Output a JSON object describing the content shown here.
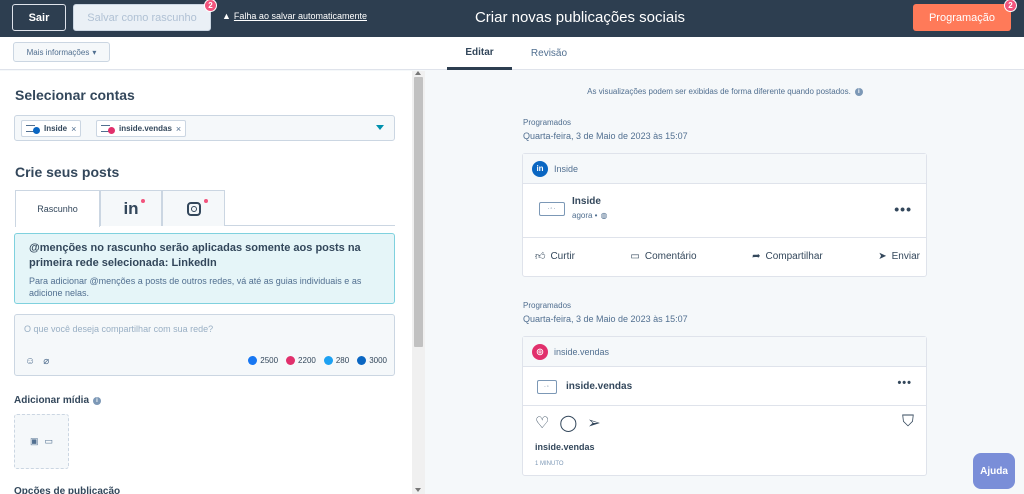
{
  "topbar": {
    "exit_label": "Sair",
    "draft_label": "Salvar como rascunho",
    "draft_badge": "2",
    "autosave_warning": "Falha ao salvar automaticamente",
    "page_title": "Criar novas publicações sociais",
    "schedule_label": "Programação",
    "schedule_badge": "2"
  },
  "tabbar": {
    "more_info": "Mais informações",
    "tab_edit": "Editar",
    "tab_review": "Revisão"
  },
  "left": {
    "select_accounts_title": "Selecionar contas",
    "accounts": [
      {
        "name": "Inside",
        "color": "#0a66c2"
      },
      {
        "name": "inside.vendas",
        "color": "#e1306c"
      }
    ],
    "create_posts_title": "Crie seus posts",
    "draft_tab": "Rascunho",
    "linkedin_tab_glyph": "in",
    "info_title": "@menções no rascunho serão aplicadas somente aos posts na primeira rede selecionada: LinkedIn",
    "info_body": "Para adicionar @menções a posts de outros redes, vá até as guias individuais e as adicione nelas.",
    "composer_placeholder": "O que você deseja compartilhar com sua rede?",
    "counts": [
      {
        "value": "2500",
        "color": "#1877f2",
        "glyph": "f"
      },
      {
        "value": "2200",
        "color": "#e1306c",
        "glyph": "◎"
      },
      {
        "value": "280",
        "color": "#1da1f2",
        "glyph": "t"
      },
      {
        "value": "3000",
        "color": "#0a66c2",
        "glyph": "in"
      }
    ],
    "add_media_label": "Adicionar mídia",
    "publish_options_label": "Opções de publicação"
  },
  "right": {
    "preview_note": "As visualizações podem ser exibidas de forma diferente quando postados.",
    "scheduled_label": "Programados",
    "scheduled_date": "Quarta-feira, 3 de Maio de 2023 às 15:07",
    "linkedin_card": {
      "header_name": "Inside",
      "author": "Inside",
      "meta": "agora •",
      "actions": [
        "Curtir",
        "Comentário",
        "Compartilhar",
        "Enviar"
      ]
    },
    "instagram_card": {
      "header_name": "inside.vendas",
      "author": "inside.vendas",
      "caption_author": "inside.vendas",
      "time": "1 MINUTO"
    }
  },
  "help_label": "Ajuda",
  "colors": {
    "topbar": "#2d3e50",
    "accent": "#ff7a59",
    "linkedin": "#0a66c2",
    "instagram": "#e1306c",
    "help": "#7a8ed8"
  }
}
